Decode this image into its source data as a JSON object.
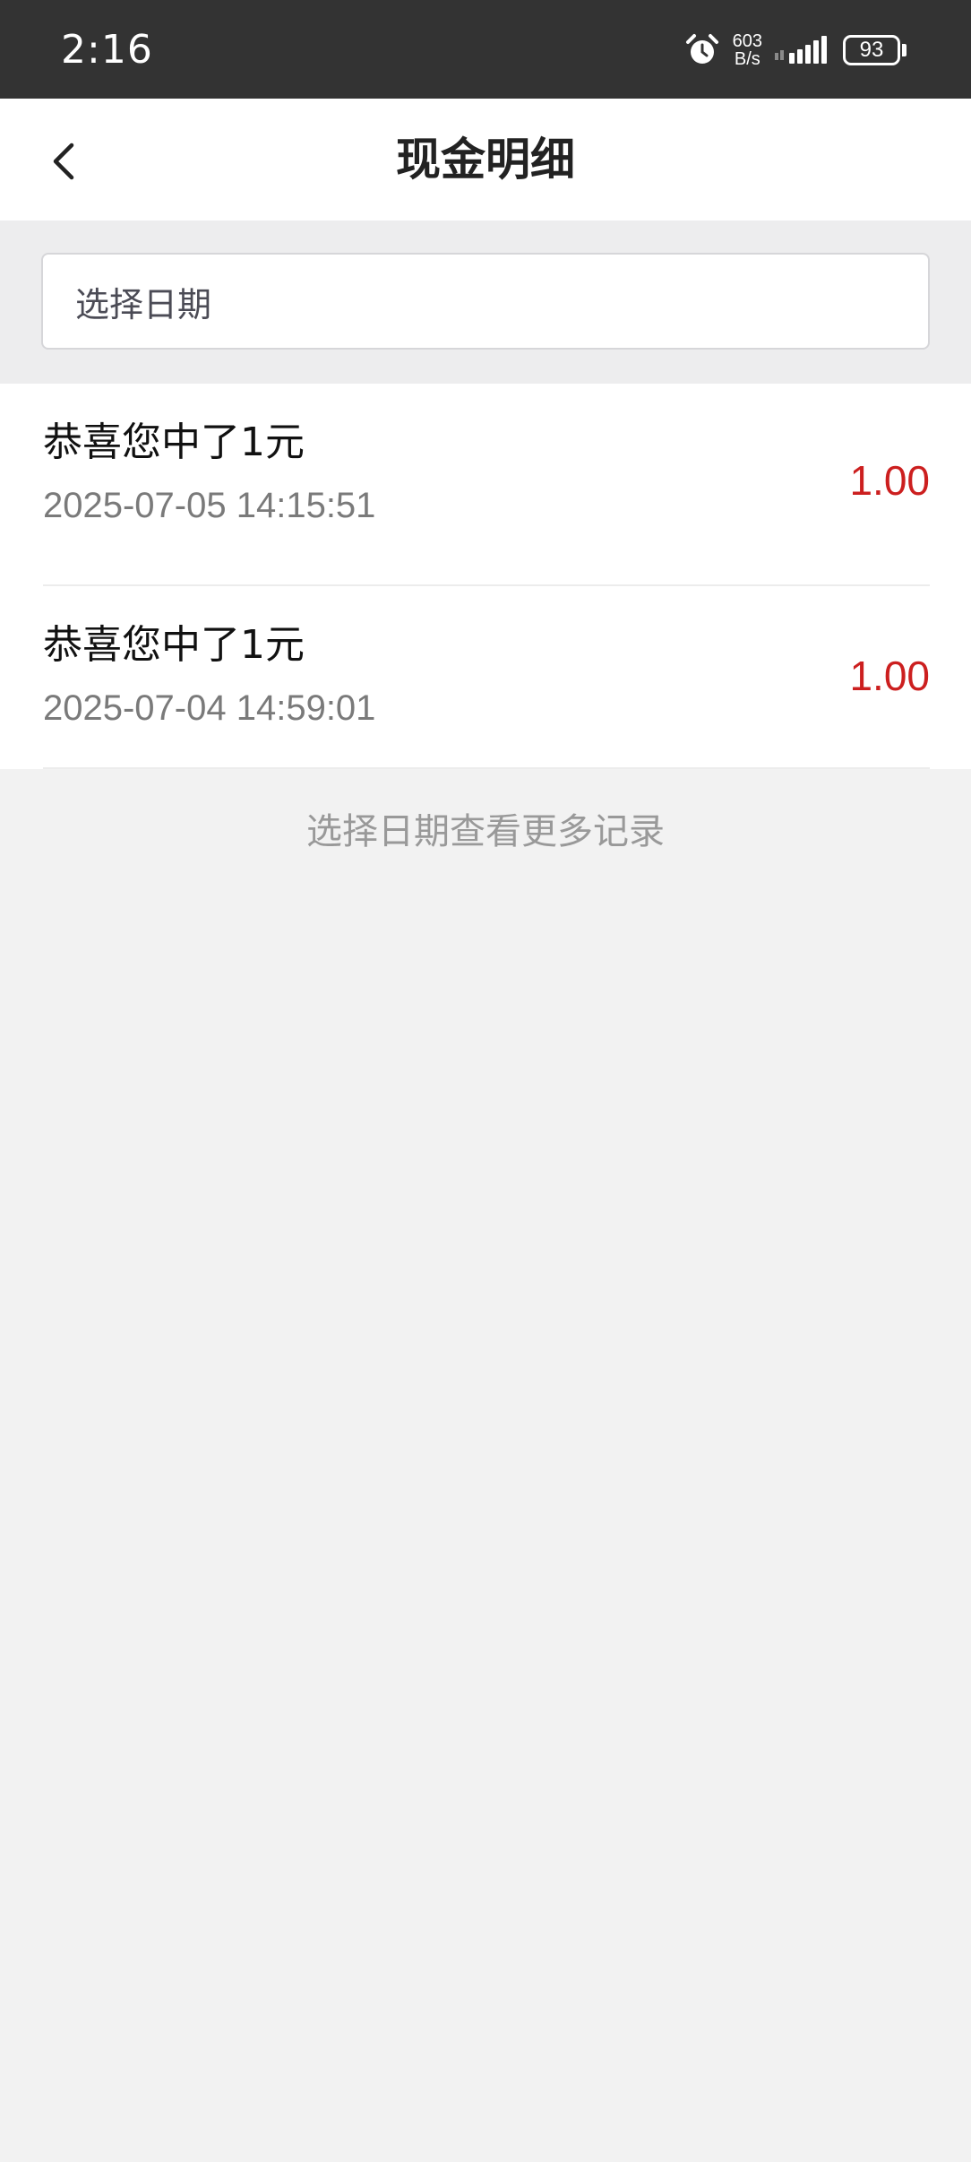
{
  "status_bar": {
    "time": "2:16",
    "net_speed_value": "603",
    "net_speed_unit": "B/s",
    "battery": "93",
    "icons": [
      "alarm-icon",
      "signal-icon",
      "battery-icon"
    ]
  },
  "header": {
    "title": "现金明细",
    "back_icon": "chevron-left-icon"
  },
  "date_picker": {
    "label": "选择日期"
  },
  "records": [
    {
      "title": "恭喜您中了1元",
      "time": "2025-07-05 14:15:51",
      "amount": "1.00"
    },
    {
      "title": "恭喜您中了1元",
      "time": "2025-07-04 14:59:01",
      "amount": "1.00"
    }
  ],
  "footer_hint": "选择日期查看更多记录",
  "colors": {
    "status_bar": "#333333",
    "amount": "#cc1f1f",
    "background": "#f2f2f2"
  }
}
